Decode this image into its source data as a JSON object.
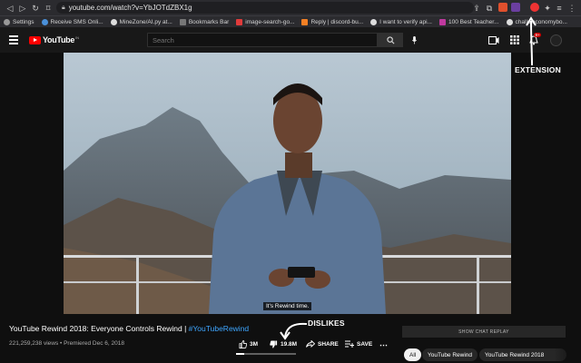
{
  "browser": {
    "url": "youtube.com/watch?v=YbJOTdZBX1g",
    "bookmarks": [
      {
        "label": "Settings"
      },
      {
        "label": "Receive SMS Onli..."
      },
      {
        "label": "MineZone/AI.py at..."
      },
      {
        "label": "Bookmarks Bar"
      },
      {
        "label": "image-search-go..."
      },
      {
        "label": "Reply | discord-bu..."
      },
      {
        "label": "I want to verify api..."
      },
      {
        "label": "100 Best Teacher..."
      },
      {
        "label": "challs/economybo..."
      }
    ]
  },
  "header": {
    "logo_text": "YouTube",
    "country_code": "IN",
    "search_placeholder": "Search",
    "notification_count": "9+"
  },
  "video": {
    "caption": "It's Rewind time.",
    "title_main": "YouTube Rewind 2018: Everyone Controls Rewind | ",
    "title_tag": "#YouTubeRewind",
    "meta": "221,259,238 views • Premiered Dec 6, 2018",
    "likes": "3M",
    "dislikes": "19.8M",
    "share_label": "SHARE",
    "save_label": "SAVE",
    "like_ratio": 0.13
  },
  "sidebar": {
    "chat_replay_label": "SHOW CHAT REPLAY",
    "chips": [
      "All",
      "YouTube Rewind",
      "YouTube Rewind 2018"
    ]
  },
  "annotations": {
    "extension_label": "EXTENSION",
    "dislikes_label": "DISLIKES"
  },
  "colors": {
    "accent_red": "#ff0000",
    "link_blue": "#3ea6ff"
  }
}
